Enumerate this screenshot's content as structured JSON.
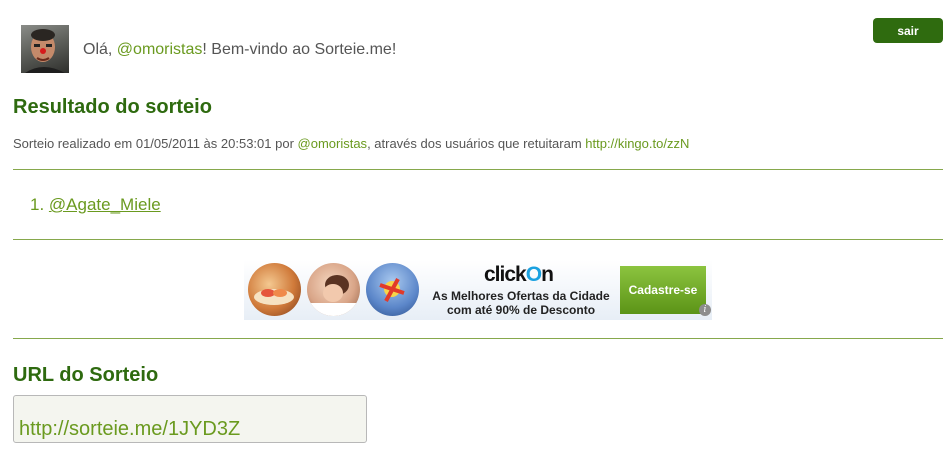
{
  "header": {
    "greeting_prefix": "Olá, ",
    "username": "@omoristas",
    "greeting_suffix": "! Bem-vindo ao Sorteie.me!",
    "logout_label": "sair"
  },
  "result": {
    "title": "Resultado do sorteio",
    "meta_prefix": "Sorteio realizado em 01/05/2011 às 20:53:01 por ",
    "meta_user": "@omoristas",
    "meta_middle": ", através dos usuários que retuitaram ",
    "meta_link": "http://kingo.to/zzN",
    "winners": [
      {
        "number": "1.",
        "handle": "@Agate_Miele"
      }
    ]
  },
  "ad": {
    "brand_part1": "click",
    "brand_o": "O",
    "brand_part2": "n",
    "tagline_1": "As Melhores Ofertas da Cidade",
    "tagline_2": "com até 90% de Desconto",
    "cta": "Cadastre-se",
    "info_glyph": "i"
  },
  "url_section": {
    "title": "URL do Sorteio",
    "value": "http://sorteie.me/1JYD3Z"
  },
  "colors": {
    "accent_green": "#2e6a0f",
    "link_green": "#6a9a1f",
    "button_green": "#2f6b0f"
  }
}
